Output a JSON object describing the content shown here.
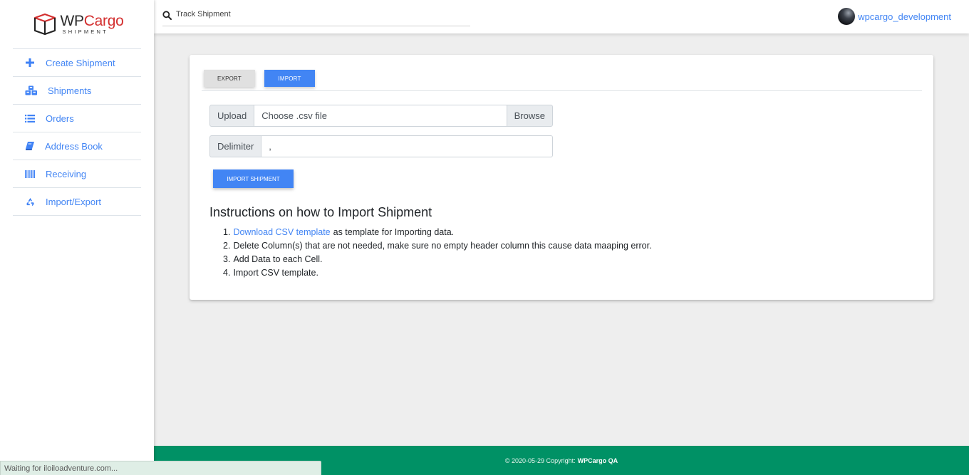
{
  "brand": {
    "name_part1": "WP",
    "name_part2": "Cargo",
    "subtitle": "SHIPMENT",
    "accent_color": "#d32f2f"
  },
  "sidebar": {
    "items": [
      {
        "label": "Create Shipment",
        "icon": "plus-icon"
      },
      {
        "label": "Shipments",
        "icon": "cubes-icon"
      },
      {
        "label": "Orders",
        "icon": "list-icon"
      },
      {
        "label": "Address Book",
        "icon": "book-icon"
      },
      {
        "label": "Receiving",
        "icon": "barcode-icon"
      },
      {
        "label": "Import/Export",
        "icon": "recycle-icon"
      }
    ]
  },
  "header": {
    "search_placeholder": "Track Shipment",
    "username": "wpcargo_development"
  },
  "main": {
    "tabs": {
      "export_label": "EXPORT",
      "import_label": "IMPORT"
    },
    "upload": {
      "label": "Upload",
      "value": "Choose .csv file",
      "browse_label": "Browse"
    },
    "delimiter": {
      "label": "Delimiter",
      "value": ","
    },
    "import_button_label": "IMPORT SHIPMENT",
    "instructions": {
      "title": "Instructions on how to Import Shipment",
      "steps": [
        {
          "num": "1.",
          "link": "Download CSV template",
          "text": "as template for Importing data."
        },
        {
          "num": "2.",
          "text": "Delete Column(s) that are not needed, make sure no empty header column this cause data maaping error."
        },
        {
          "num": "3.",
          "text": "Add Data to each Cell."
        },
        {
          "num": "4.",
          "text": "Import CSV template."
        }
      ]
    }
  },
  "footer": {
    "copyright": "© 2020-05-29 Copyright:",
    "owner": "WPCargo QA",
    "color": "#009165"
  },
  "browser_status": "Waiting for iloiloadventure.com..."
}
